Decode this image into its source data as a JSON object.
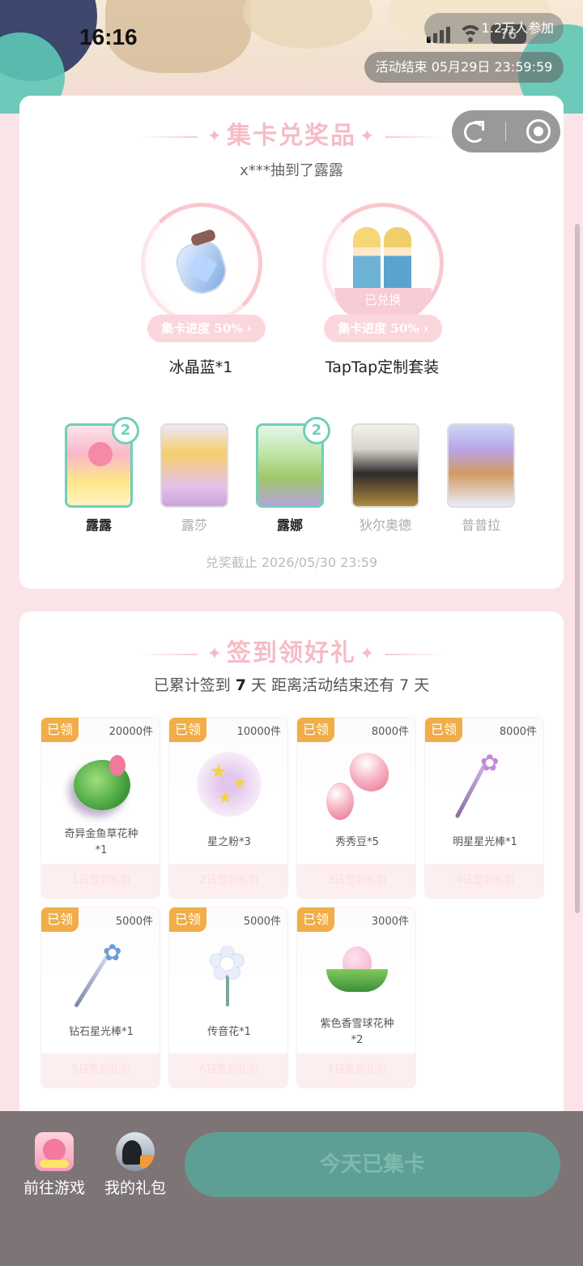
{
  "status_bar": {
    "time": "16:16",
    "battery": "76"
  },
  "header": {
    "join_text": "1.2万人参加",
    "end_text": "活动结束 05月29日 23:59:59"
  },
  "card_exchange": {
    "title": "集卡兑奖品",
    "winner_text": "x***抽到了露露",
    "prizes": [
      {
        "name": "冰晶蓝*1",
        "progress": "集卡进度 50%",
        "claimed": ""
      },
      {
        "name": "TapTap定制套装",
        "progress": "集卡进度 50%",
        "claimed": "已兑换"
      }
    ],
    "characters": [
      {
        "name": "露露",
        "count": "2",
        "active": true
      },
      {
        "name": "露莎",
        "count": "",
        "active": false
      },
      {
        "name": "露娜",
        "count": "2",
        "active": true
      },
      {
        "name": "狄尔奥德",
        "count": "",
        "active": false
      },
      {
        "name": "普普拉",
        "count": "",
        "active": false
      }
    ],
    "deadline": "兑奖截止 2026/05/30 23:59"
  },
  "card_signin": {
    "title": "签到领好礼",
    "sub_prefix": "已累计签到",
    "days_signed": "7",
    "sub_middle": "天  距离活动结束还有",
    "days_left": "7",
    "sub_suffix": "天",
    "gifts": [
      {
        "tag": "已领",
        "count": "20000件",
        "label": "奇异金鱼草花种\n*1",
        "day": "1日签到礼包",
        "icon": "seed-icon"
      },
      {
        "tag": "已领",
        "count": "10000件",
        "label": "星之粉*3",
        "day": "2日签到礼包",
        "icon": "star-powder-icon"
      },
      {
        "tag": "已领",
        "count": "8000件",
        "label": "秀秀豆*5",
        "day": "3日签到礼包",
        "icon": "bean-icon"
      },
      {
        "tag": "已领",
        "count": "8000件",
        "label": "明星星光棒*1",
        "day": "4日签到礼包",
        "icon": "wand-icon"
      },
      {
        "tag": "已领",
        "count": "5000件",
        "label": "钻石星光棒*1",
        "day": "5日签到礼包",
        "icon": "diamond-wand-icon"
      },
      {
        "tag": "已领",
        "count": "5000件",
        "label": "传音花*1",
        "day": "6日签到礼包",
        "icon": "flower-icon"
      },
      {
        "tag": "已领",
        "count": "3000件",
        "label": "紫色香雪球花种\n*2",
        "day": "7日签到礼包",
        "icon": "lotus-seed-icon"
      }
    ]
  },
  "bottom_bar": {
    "go_game": "前往游戏",
    "my_gifts": "我的礼包",
    "cta": "今天已集卡"
  },
  "colors": {
    "accent_teal": "#6fd0b6",
    "tag_orange": "#f1ad47",
    "title_pink": "#f5bcc6",
    "cta_green": "#5e9f95"
  }
}
